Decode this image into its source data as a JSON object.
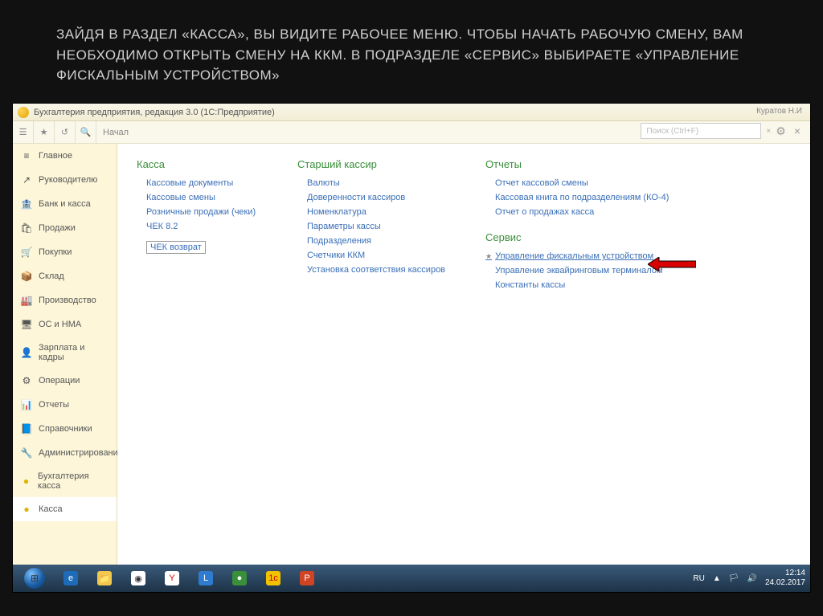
{
  "slide": {
    "title": "ЗАЙДЯ В РАЗДЕЛ «КАССА», ВЫ ВИДИТЕ РАБОЧЕЕ МЕНЮ. ЧТОБЫ НАЧАТЬ РАБОЧУЮ СМЕНУ, ВАМ НЕОБХОДИМО ОТКРЫТЬ СМЕНУ НА ККМ. В ПОДРАЗДЕЛЕ «СЕРВИС» ВЫБИРАЕТЕ «УПРАВЛЕНИЕ ФИСКАЛЬНЫМ УСТРОЙСТВОМ»"
  },
  "window": {
    "title": "Бухгалтерия предприятия, редакция 3.0 (1С:Предприятие)",
    "user": "Куратов Н.И"
  },
  "toolbar": {
    "nav_label": "Начал",
    "search_placeholder": "Поиск (Ctrl+F)"
  },
  "sidebar": {
    "items": [
      {
        "icon": "≡",
        "label": "Главное"
      },
      {
        "icon": "↗",
        "label": "Руководителю"
      },
      {
        "icon": "🏦",
        "label": "Банк и касса"
      },
      {
        "icon": "🛍",
        "label": "Продажи"
      },
      {
        "icon": "🛒",
        "label": "Покупки"
      },
      {
        "icon": "📦",
        "label": "Склад"
      },
      {
        "icon": "🏭",
        "label": "Производство"
      },
      {
        "icon": "🖥",
        "label": "ОС и НМА"
      },
      {
        "icon": "👤",
        "label": "Зарплата и кадры"
      },
      {
        "icon": "⚙",
        "label": "Операции"
      },
      {
        "icon": "📊",
        "label": "Отчеты"
      },
      {
        "icon": "📘",
        "label": "Справочники"
      },
      {
        "icon": "🔧",
        "label": "Администрирование"
      },
      {
        "icon": "●",
        "label": "Бухгалтерия касса"
      },
      {
        "icon": "●",
        "label": "Касса"
      }
    ]
  },
  "columns": {
    "kassa": {
      "title": "Касса",
      "items": [
        "Кассовые документы",
        "Кассовые смены",
        "Розничные продажи (чеки)",
        "ЧЕК 8.2",
        "ЧЕК возврат"
      ]
    },
    "senior": {
      "title": "Старший кассир",
      "items": [
        "Валюты",
        "Доверенности кассиров",
        "Номенклатура",
        "Параметры кассы",
        "Подразделения",
        "Счетчики ККМ",
        "Установка соответствия кассиров"
      ]
    },
    "reports": {
      "title": "Отчеты",
      "items": [
        "Отчет кассовой смены",
        "Кассовая книга по подразделениям (КО-4)",
        "Отчет о продажах касса"
      ]
    },
    "service": {
      "title": "Сервис",
      "items": [
        "Управление фискальным устройством",
        "Управление эквайринговым терминалом",
        "Константы кассы"
      ]
    }
  },
  "taskbar": {
    "lang": "RU",
    "time": "12:14",
    "date": "24.02.2017"
  }
}
